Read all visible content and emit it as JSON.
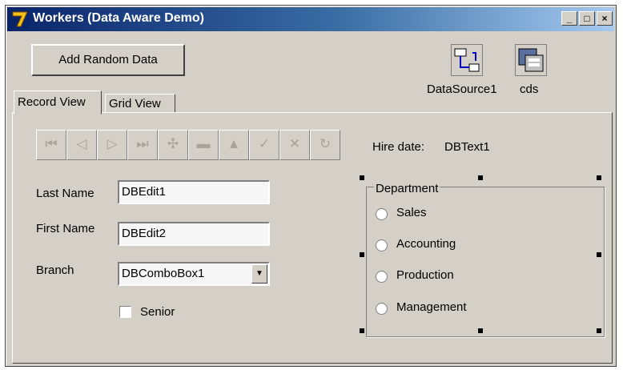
{
  "window": {
    "title": "Workers (Data Aware Demo)",
    "controls": {
      "minimize": "_",
      "maximize": "□",
      "close": "×"
    }
  },
  "toolbar": {
    "add_random_label": "Add Random Data",
    "components": [
      {
        "label": "DataSource1",
        "icon": "datasource-icon"
      },
      {
        "label": "cds",
        "icon": "clientdataset-icon"
      }
    ]
  },
  "tabs": [
    {
      "label": "Record View",
      "active": true
    },
    {
      "label": "Grid View",
      "active": false
    }
  ],
  "navigator": {
    "buttons": [
      {
        "name": "first",
        "glyph": "⏮"
      },
      {
        "name": "prior",
        "glyph": "◁"
      },
      {
        "name": "next",
        "glyph": "▷"
      },
      {
        "name": "last",
        "glyph": "⏭"
      },
      {
        "name": "insert",
        "glyph": "✣"
      },
      {
        "name": "delete",
        "glyph": "▬"
      },
      {
        "name": "edit",
        "glyph": "▲"
      },
      {
        "name": "post",
        "glyph": "✓"
      },
      {
        "name": "cancel",
        "glyph": "✕"
      },
      {
        "name": "refresh",
        "glyph": "↻"
      }
    ]
  },
  "form": {
    "last_name_label": "Last Name",
    "last_name_value": "DBEdit1",
    "first_name_label": "First Name",
    "first_name_value": "DBEdit2",
    "branch_label": "Branch",
    "branch_value": "DBComboBox1",
    "senior_label": "Senior",
    "hire_date_label": "Hire date:",
    "hire_date_value": "DBText1"
  },
  "department": {
    "title": "Department",
    "options": [
      "Sales",
      "Accounting",
      "Production",
      "Management"
    ]
  }
}
